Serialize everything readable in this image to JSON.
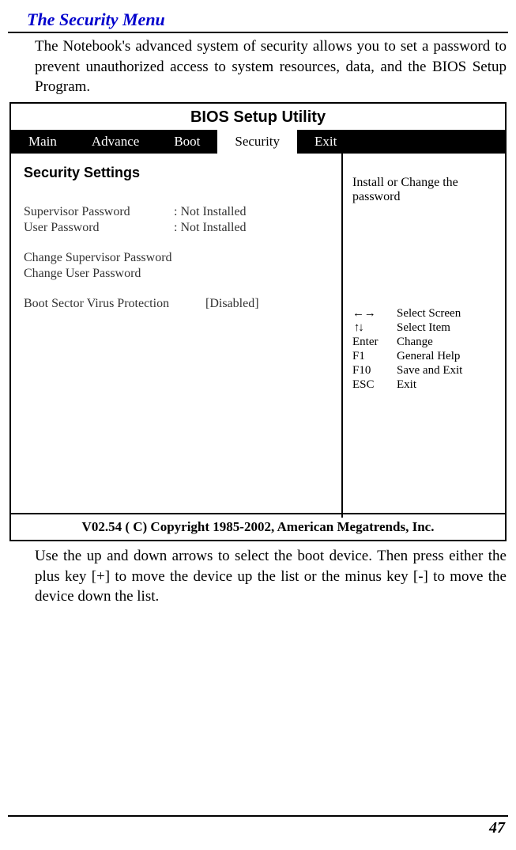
{
  "heading": "The Security Menu",
  "intro": "The Notebook's advanced system of security allows you to set a password to prevent unauthorized access to system resources, data, and the BIOS Setup Program.",
  "bios": {
    "title": "BIOS Setup Utility",
    "tabs": [
      "Main",
      "Advance",
      "Boot",
      "Security",
      "Exit"
    ],
    "activeTabIndex": 3,
    "sectionHead": "Security Settings",
    "settings": [
      {
        "label": "Supervisor Password",
        "value": ": Not Installed"
      },
      {
        "label": "User Password",
        "value": ": Not Installed"
      }
    ],
    "actions": [
      "Change Supervisor Password",
      "Change User Password"
    ],
    "extra": {
      "label": "Boot Sector Virus Protection",
      "value": "[Disabled]"
    },
    "helpText": "Install or Change the password",
    "keyhints": [
      {
        "key": "←→",
        "desc": "Select Screen"
      },
      {
        "key": "↑↓",
        "desc": "Select Item"
      },
      {
        "key": "Enter",
        "desc": "Change"
      },
      {
        "key": "F1",
        "desc": "General Help"
      },
      {
        "key": "F10",
        "desc": "Save and Exit"
      },
      {
        "key": "ESC",
        "desc": "Exit"
      }
    ],
    "footer": "V02.54  ( C) Copyright 1985-2002, American Megatrends, Inc."
  },
  "outro": "Use the up and down arrows to select the boot device.  Then press either the plus key [+] to move the device up the list or the minus key [-] to move the device down the list.",
  "pageNumber": "47"
}
